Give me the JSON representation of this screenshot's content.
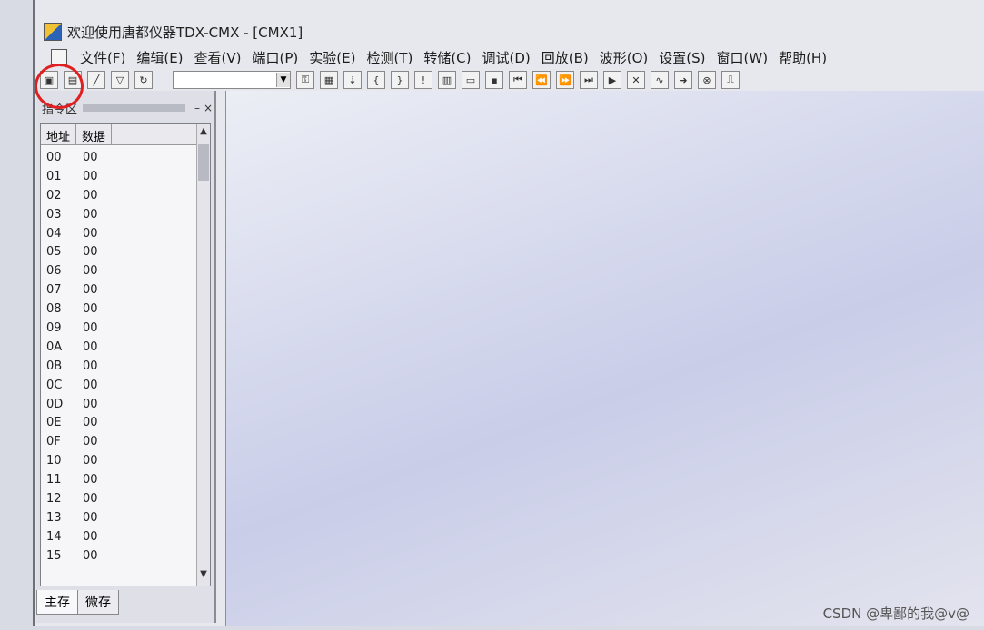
{
  "window": {
    "title": "欢迎使用唐都仪器TDX-CMX - [CMX1]"
  },
  "menubar": {
    "items": [
      "文件(F)",
      "编辑(E)",
      "查看(V)",
      "端口(P)",
      "实验(E)",
      "检测(T)",
      "转储(C)",
      "调试(D)",
      "回放(B)",
      "波形(O)",
      "设置(S)",
      "窗口(W)",
      "帮助(H)"
    ]
  },
  "panel": {
    "title": "指令区",
    "columns": [
      "地址",
      "数据"
    ],
    "rows": [
      {
        "addr": "00",
        "val": "00"
      },
      {
        "addr": "01",
        "val": "00"
      },
      {
        "addr": "02",
        "val": "00"
      },
      {
        "addr": "03",
        "val": "00"
      },
      {
        "addr": "04",
        "val": "00"
      },
      {
        "addr": "05",
        "val": "00"
      },
      {
        "addr": "06",
        "val": "00"
      },
      {
        "addr": "07",
        "val": "00"
      },
      {
        "addr": "08",
        "val": "00"
      },
      {
        "addr": "09",
        "val": "00"
      },
      {
        "addr": "0A",
        "val": "00"
      },
      {
        "addr": "0B",
        "val": "00"
      },
      {
        "addr": "0C",
        "val": "00"
      },
      {
        "addr": "0D",
        "val": "00"
      },
      {
        "addr": "0E",
        "val": "00"
      },
      {
        "addr": "0F",
        "val": "00"
      },
      {
        "addr": "10",
        "val": "00"
      },
      {
        "addr": "11",
        "val": "00"
      },
      {
        "addr": "12",
        "val": "00"
      },
      {
        "addr": "13",
        "val": "00"
      },
      {
        "addr": "14",
        "val": "00"
      },
      {
        "addr": "15",
        "val": "00"
      }
    ],
    "tabs": [
      "主存",
      "微存"
    ]
  },
  "watermark": "CSDN @卑鄙的我@v@"
}
